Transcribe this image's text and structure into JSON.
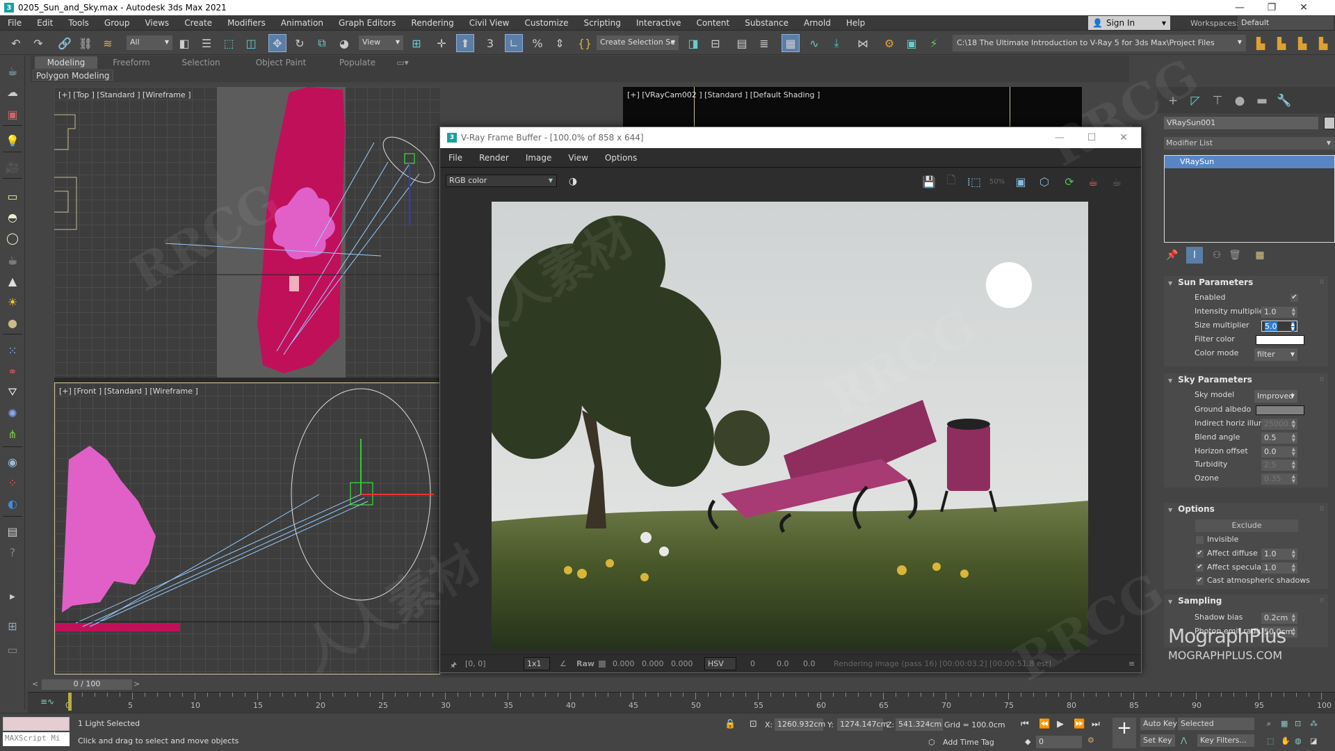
{
  "window": {
    "title": "0205_Sun_and_Sky.max - Autodesk 3ds Max 2021",
    "app_icon": "3",
    "minimize": "—",
    "maximize": "❐",
    "close": "✕"
  },
  "menu": [
    "File",
    "Edit",
    "Tools",
    "Group",
    "Views",
    "Create",
    "Modifiers",
    "Animation",
    "Graph Editors",
    "Rendering",
    "Civil View",
    "Customize",
    "Scripting",
    "Interactive",
    "Content",
    "Substance",
    "Arnold",
    "Help"
  ],
  "account": {
    "sign_in": "Sign In",
    "workspaces_label": "Workspaces:",
    "workspace": "Default"
  },
  "main_toolbar": {
    "selection_filter": "All",
    "ref_coord": "View",
    "named_selection": "Create Selection Se",
    "project_path": "C:\\18 The Ultimate Introduction to V-Ray 5 for 3ds Max\\Project Files"
  },
  "ribbon": {
    "tabs": [
      "Modeling",
      "Freeform",
      "Selection",
      "Object Paint",
      "Populate"
    ],
    "active_tab": "Modeling",
    "sub_label": "Polygon Modeling"
  },
  "viewports": {
    "top": "[+] [Top ] [Standard ] [Wireframe ]",
    "front": "[+] [Front ] [Standard ] [Wireframe ]",
    "camera": "[+] [VRayCam002 ] [Standard ] [Default Shading ]"
  },
  "frame_buffer": {
    "title": "V-Ray Frame Buffer - [100.0% of 858 x 644]",
    "menu": [
      "File",
      "Render",
      "Image",
      "View",
      "Options"
    ],
    "channel": "RGB color",
    "zoom_badge": "50%",
    "status": {
      "coords": "[0, 0]",
      "sample": "1x1",
      "raw_label": "Raw",
      "rgb": [
        "0.000",
        "0.000",
        "0.000"
      ],
      "color_space": "HSV",
      "hsv": [
        "0",
        "0.0",
        "0.0"
      ],
      "message": "Rendering image (pass 16) [00:00:03.2] [00:00:51.8 est]"
    }
  },
  "command_panel": {
    "object_name": "VRaySun001",
    "modifier_list": "Modifier List",
    "stack_item": "VRaySun",
    "sun_parameters": {
      "title": "Sun Parameters",
      "enabled_label": "Enabled",
      "enabled": true,
      "intensity_label": "Intensity multiplier",
      "intensity": "1.0",
      "size_label": "Size multiplier",
      "size": "5.0",
      "filter_color_label": "Filter color",
      "filter_color": "#ffffff",
      "color_mode_label": "Color mode",
      "color_mode": "filter"
    },
    "sky_parameters": {
      "title": "Sky Parameters",
      "sky_model_label": "Sky model",
      "sky_model": "Improved",
      "ground_albedo_label": "Ground albedo",
      "ground_albedo": "#808080",
      "indirect_label": "Indirect horiz illum",
      "indirect": "25000.0",
      "blend_label": "Blend angle",
      "blend": "0.5",
      "horizon_label": "Horizon offset",
      "horizon": "0.0",
      "turbidity_label": "Turbidity",
      "turbidity": "2.5",
      "ozone_label": "Ozone",
      "ozone": "0.35"
    },
    "options": {
      "title": "Options",
      "exclude": "Exclude",
      "invisible_label": "Invisible",
      "invisible": false,
      "affect_diffuse_label": "Affect diffuse",
      "affect_diffuse": "1.0",
      "affect_specular_label": "Affect specula",
      "affect_specular": "1.0",
      "cast_shadows_label": "Cast atmospheric shadows"
    },
    "sampling": {
      "title": "Sampling",
      "shadow_bias_label": "Shadow bias",
      "shadow_bias": "0.2cm",
      "photon_label": "Photon emit radius",
      "photon": "50.0cm"
    },
    "brand": "MographPlus",
    "brand_url": "MOGRAPHPLUS.COM"
  },
  "timeline": {
    "frame_display": "0 / 100",
    "ticks": [
      "0",
      "5",
      "10",
      "15",
      "20",
      "25",
      "30",
      "35",
      "40",
      "45",
      "50",
      "55",
      "60",
      "65",
      "70",
      "75",
      "80",
      "85",
      "90",
      "95",
      "100"
    ]
  },
  "status_bar": {
    "selection": "1 Light Selected",
    "prompt": "Click and drag to select and move objects",
    "maxscript": "MAXScript Mi",
    "x_label": "X:",
    "x": "1260.932cm",
    "y_label": "Y:",
    "y": "1274.147cm",
    "z_label": "Z:",
    "z": "541.324cm",
    "grid": "Grid = 100.0cm",
    "add_time_tag": "Add Time Tag",
    "current_frame": "0",
    "auto_key": "Auto Key",
    "set_key": "Set Key",
    "key_mode": "Selected",
    "key_filters": "Key Filters..."
  },
  "watermarks": [
    "RRCG",
    "人人素材",
    "RRCG",
    "人人素材",
    "RRCG",
    "RRCG"
  ]
}
